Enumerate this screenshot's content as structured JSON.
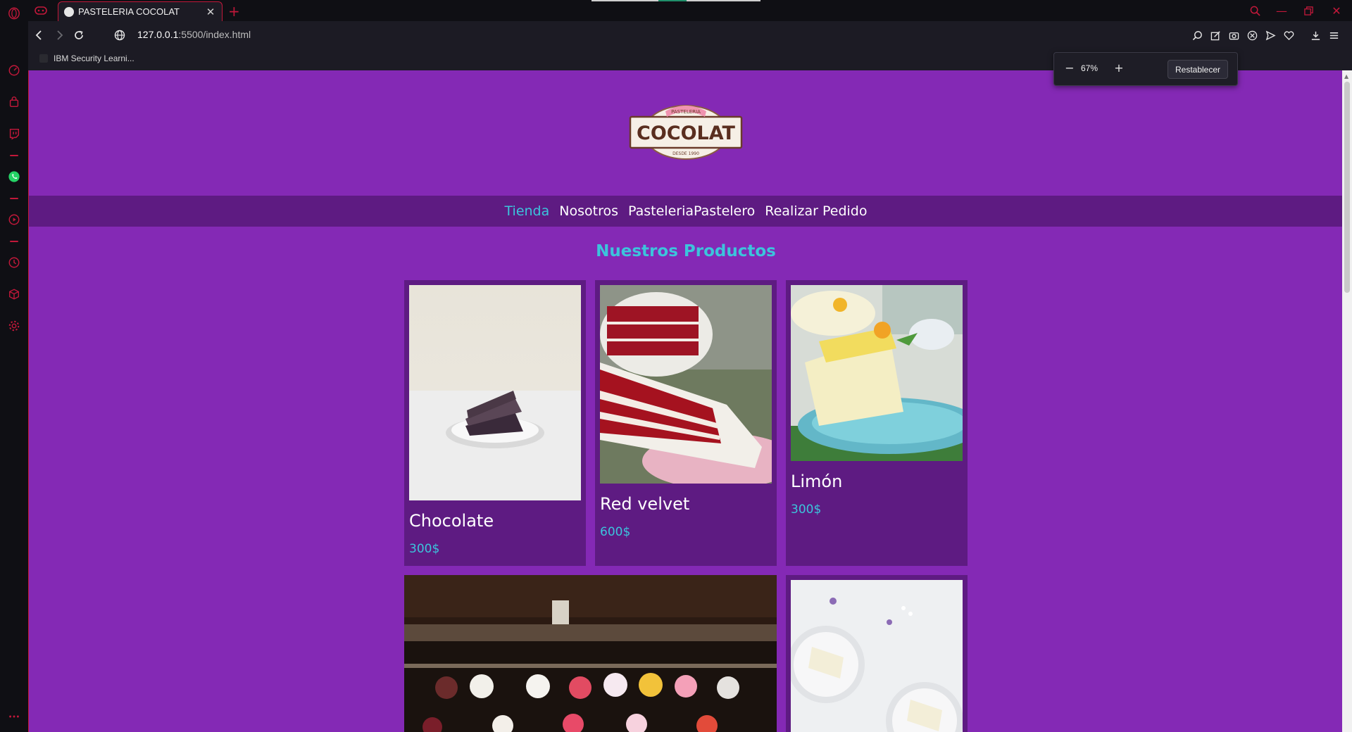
{
  "browser": {
    "tab": {
      "title": "PASTELERIA COCOLAT"
    },
    "address": {
      "host": "127.0.0.1",
      "rest": ":5500/index.html"
    },
    "bookmarks": [
      {
        "label": "IBM Security Learni..."
      }
    ],
    "zoom": {
      "value": "67%",
      "minus": "−",
      "plus": "+",
      "reset_label": "Restablecer"
    },
    "accent_color": "#c2183a"
  },
  "page": {
    "logo": {
      "top": "PASTELERIA",
      "main": "COCOLAT",
      "bottom": "DESDE 1990"
    },
    "nav": [
      {
        "label": "Tienda",
        "active": true
      },
      {
        "label": "Nosotros",
        "active": false
      },
      {
        "label": "PasteleriaPastelero",
        "active": false
      },
      {
        "label": "Realizar Pedido",
        "active": false
      }
    ],
    "section_title": "Nuestros Productos",
    "products": [
      {
        "name": "Chocolate",
        "price": "300$"
      },
      {
        "name": "Red velvet",
        "price": "600$"
      },
      {
        "name": "Limón",
        "price": "300$"
      }
    ],
    "colors": {
      "background": "#8429b5",
      "nav_bg": "#5e1b82",
      "card_bg": "#5e1b82",
      "accent": "#3cc4dc"
    }
  }
}
